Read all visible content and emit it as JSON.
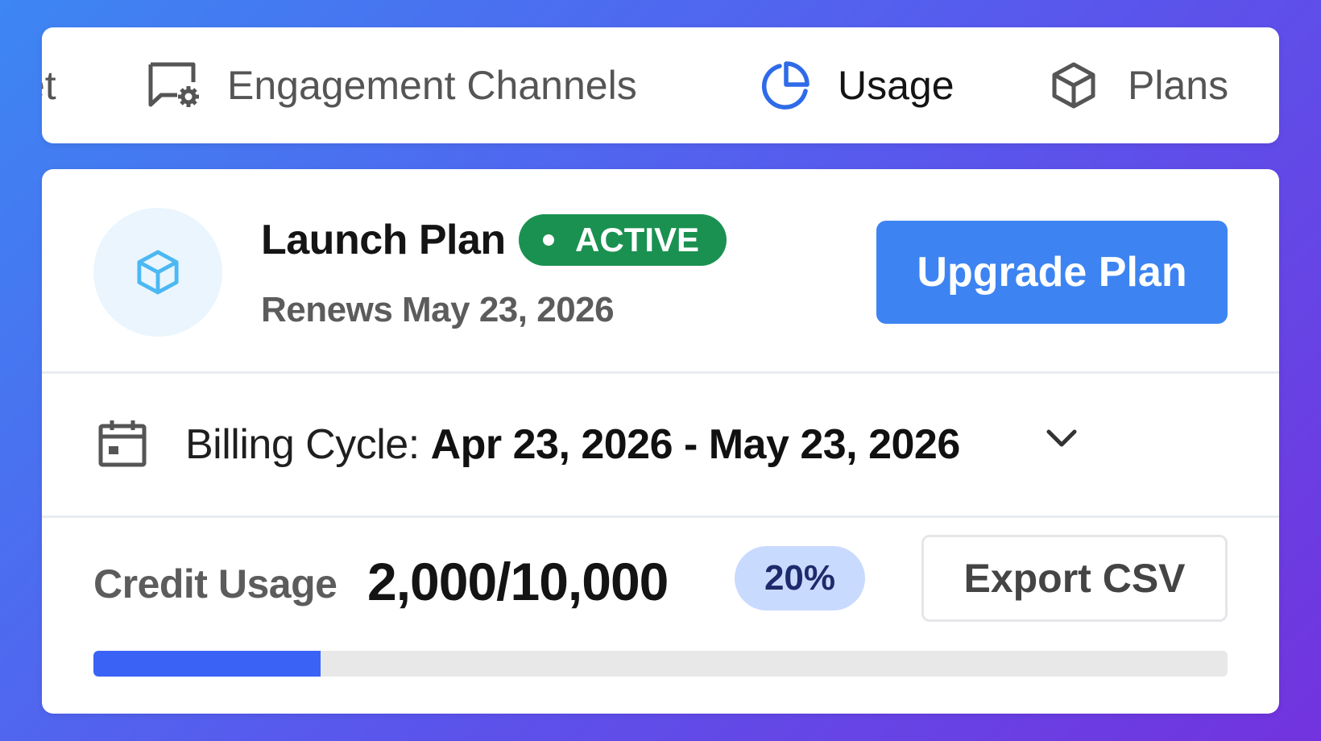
{
  "tabs": [
    {
      "label": "et",
      "icon": "unknown-cutoff",
      "active": false
    },
    {
      "label": "Engagement Channels",
      "icon": "chat-settings-icon",
      "active": false
    },
    {
      "label": "Usage",
      "icon": "pie-chart-icon",
      "active": true
    },
    {
      "label": "Plans",
      "icon": "cube-icon",
      "active": false
    }
  ],
  "plan": {
    "icon": "cube-icon",
    "name": "Launch Plan",
    "status": "ACTIVE",
    "renews": "Renews May 23, 2026",
    "upgrade_label": "Upgrade Plan"
  },
  "billing": {
    "label": "Billing Cycle:",
    "range": "Apr 23, 2026 - May 23, 2026"
  },
  "credit": {
    "label": "Credit Usage",
    "value": "2,000/10,000",
    "percent_label": "20%",
    "used_fraction": 0.2,
    "export_label": "Export CSV"
  },
  "colors": {
    "accent": "#3d84f2",
    "active_badge": "#1a9150",
    "percent_badge": "#c9daff",
    "progress_fill": "#3a63f5"
  }
}
